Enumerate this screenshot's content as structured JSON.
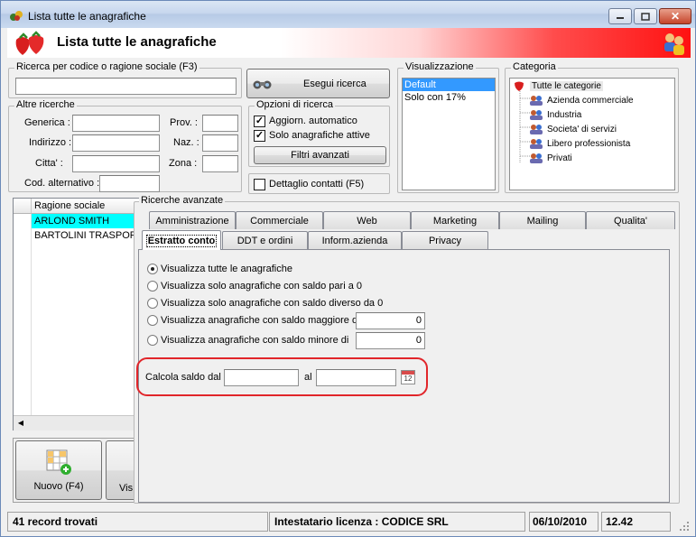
{
  "window": {
    "title": "Lista tutte le anagrafiche",
    "minimize": "–",
    "maximize": "□",
    "close": "✕"
  },
  "banner": {
    "title": "Lista tutte le anagrafiche"
  },
  "search": {
    "legend": "Ricerca per codice o ragione sociale (F3)",
    "value": "",
    "run_button": "Esegui ricerca"
  },
  "other": {
    "legend": "Altre ricerche",
    "generica": "Generica :",
    "indirizzo": "Indirizzo :",
    "citta": "Citta' :",
    "cod_alt": "Cod. alternativo :",
    "prov": "Prov. :",
    "naz": "Naz. :",
    "zona": "Zona :"
  },
  "options": {
    "legend": "Opzioni di ricerca",
    "auto_update": "Aggiorn. automatico",
    "only_active": "Solo anagrafiche attive",
    "advanced_filters": "Filtri avanzati",
    "contact_detail": "Dettaglio contatti (F5)"
  },
  "display": {
    "legend": "Visualizzazione",
    "items": [
      "Default",
      "Solo con 17%"
    ],
    "selected": "Default"
  },
  "category": {
    "legend": "Categoria",
    "root": "Tutte le categorie",
    "items": [
      "Azienda commerciale",
      "Industria",
      "Societa' di servizi",
      "Libero professionista",
      "Privati"
    ]
  },
  "grid": {
    "column": "Ragione sociale",
    "rows": [
      "ARLOND SMITH",
      "BARTOLINI TRASPOR"
    ]
  },
  "advanced": {
    "legend": "Ricerche avanzate",
    "tabs_row1": [
      "Amministrazione",
      "Commerciale",
      "Web",
      "Marketing",
      "Mailing",
      "Qualita'"
    ],
    "tabs_row2": [
      "Estratto conto",
      "DDT e ordini",
      "Inform.azienda",
      "Privacy"
    ],
    "radios": [
      "Visualizza tutte le anagrafiche",
      "Visualizza solo anagrafiche con saldo pari a 0",
      "Visualizza solo anagrafiche con saldo diverso da 0",
      "Visualizza anagrafiche con saldo maggiore di",
      "Visualizza anagrafiche con saldo minore di"
    ],
    "greater_value": "0",
    "less_value": "0",
    "calc_label": "Calcola saldo dal",
    "al_label": "al",
    "calendar_day": "12"
  },
  "toolbar": {
    "new_button": "Nuovo (F4)",
    "next_button": "Vis"
  },
  "status": {
    "records": "41 record trovati",
    "license": "Intestatario licenza : CODICE SRL",
    "date": "06/10/2010",
    "time": "12.42"
  }
}
